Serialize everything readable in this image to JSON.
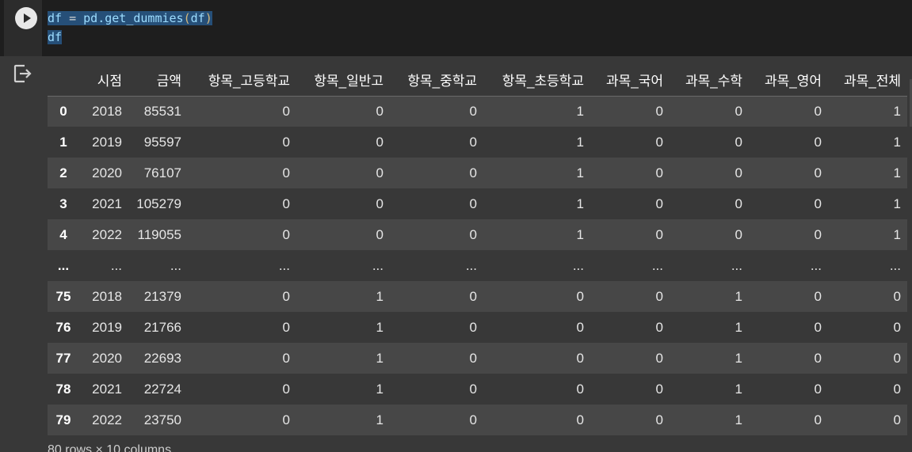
{
  "code": {
    "line1": {
      "var": "df",
      "op": " = ",
      "call": "pd.get_dummies",
      "open": "(",
      "arg": "df",
      "close": ")"
    },
    "line2": "df"
  },
  "table": {
    "columns": [
      "시점",
      "금액",
      "항목_고등학교",
      "항목_일반고",
      "항목_중학교",
      "항목_초등학교",
      "과목_국어",
      "과목_수학",
      "과목_영어",
      "과목_전체"
    ],
    "rows": [
      {
        "index": "0",
        "cells": [
          "2018",
          "85531",
          "0",
          "0",
          "0",
          "1",
          "0",
          "0",
          "0",
          "1"
        ]
      },
      {
        "index": "1",
        "cells": [
          "2019",
          "95597",
          "0",
          "0",
          "0",
          "1",
          "0",
          "0",
          "0",
          "1"
        ]
      },
      {
        "index": "2",
        "cells": [
          "2020",
          "76107",
          "0",
          "0",
          "0",
          "1",
          "0",
          "0",
          "0",
          "1"
        ]
      },
      {
        "index": "3",
        "cells": [
          "2021",
          "105279",
          "0",
          "0",
          "0",
          "1",
          "0",
          "0",
          "0",
          "1"
        ]
      },
      {
        "index": "4",
        "cells": [
          "2022",
          "119055",
          "0",
          "0",
          "0",
          "1",
          "0",
          "0",
          "0",
          "1"
        ]
      },
      {
        "index": "...",
        "cells": [
          "...",
          "...",
          "...",
          "...",
          "...",
          "...",
          "...",
          "...",
          "...",
          "..."
        ]
      },
      {
        "index": "75",
        "cells": [
          "2018",
          "21379",
          "0",
          "1",
          "0",
          "0",
          "0",
          "1",
          "0",
          "0"
        ]
      },
      {
        "index": "76",
        "cells": [
          "2019",
          "21766",
          "0",
          "1",
          "0",
          "0",
          "0",
          "1",
          "0",
          "0"
        ]
      },
      {
        "index": "77",
        "cells": [
          "2020",
          "22693",
          "0",
          "1",
          "0",
          "0",
          "0",
          "1",
          "0",
          "0"
        ]
      },
      {
        "index": "78",
        "cells": [
          "2021",
          "22724",
          "0",
          "1",
          "0",
          "0",
          "0",
          "1",
          "0",
          "0"
        ]
      },
      {
        "index": "79",
        "cells": [
          "2022",
          "23750",
          "0",
          "1",
          "0",
          "0",
          "0",
          "1",
          "0",
          "0"
        ]
      }
    ]
  },
  "footer": "80 rows × 10 columns",
  "icons": {
    "run": "play-icon",
    "output": "output-exit-icon"
  }
}
